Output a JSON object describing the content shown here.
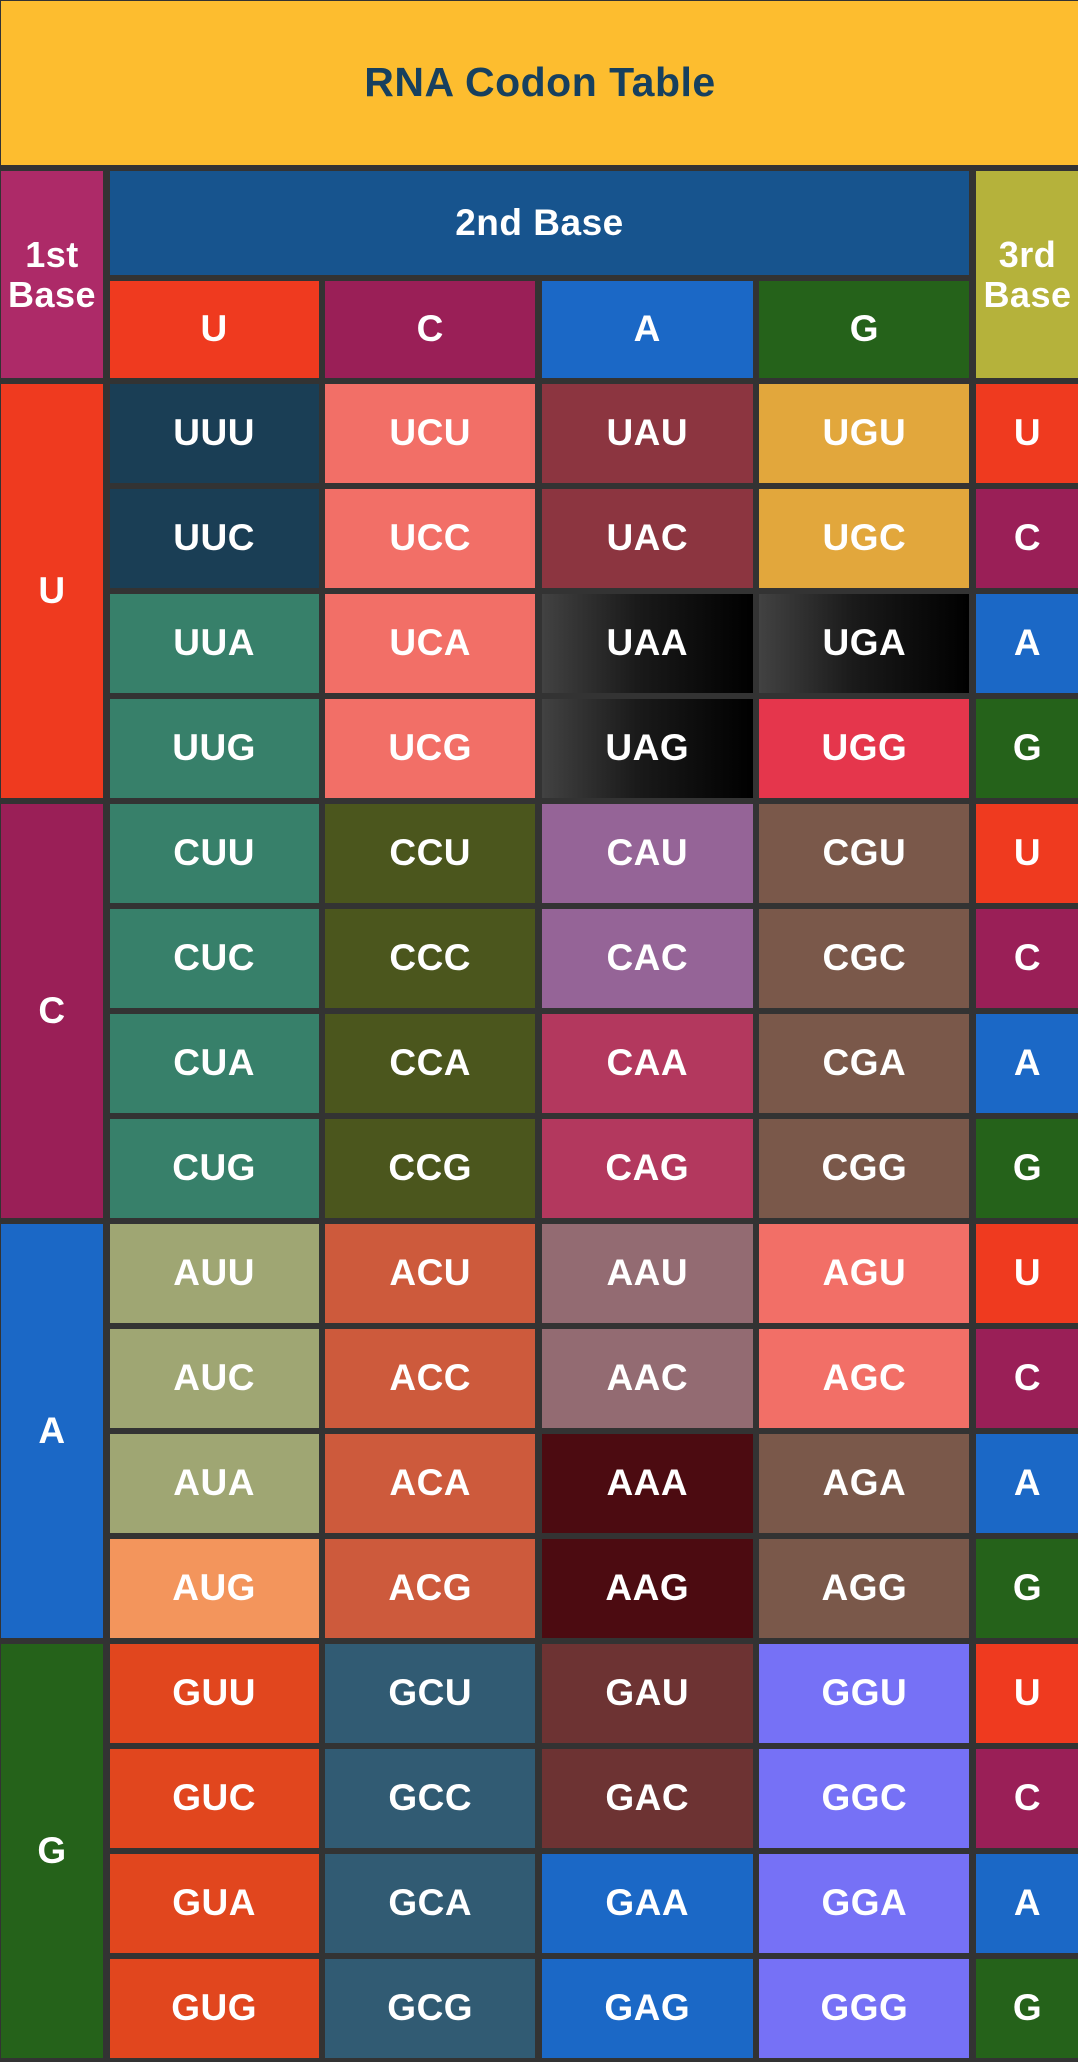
{
  "title": "RNA Codon Table",
  "headers": {
    "first_base": "1st Base",
    "second_base": "2nd Base",
    "third_base": "3rd Base"
  },
  "base_colors": {
    "U": "#ef3a1f",
    "C": "#9a1f57",
    "A": "#1b68c6",
    "G": "#25621a"
  },
  "second_base_columns": [
    {
      "label": "U",
      "color": "#ef3a1f"
    },
    {
      "label": "C",
      "color": "#9a1f57"
    },
    {
      "label": "A",
      "color": "#1b68c6"
    },
    {
      "label": "G",
      "color": "#25621a"
    }
  ],
  "first_base_rows": [
    {
      "label": "U",
      "color": "#ef3a1f"
    },
    {
      "label": "C",
      "color": "#9a1f57"
    },
    {
      "label": "A",
      "color": "#1b68c6"
    },
    {
      "label": "G",
      "color": "#25621a"
    }
  ],
  "third_base_labels": [
    "U",
    "C",
    "A",
    "G"
  ],
  "codons": [
    [
      [
        {
          "codon": "UUU",
          "color": "#1a3e55"
        },
        {
          "codon": "UCU",
          "color": "#f26f67"
        },
        {
          "codon": "UAU",
          "color": "#8c3540"
        },
        {
          "codon": "UGU",
          "color": "#e2a73c"
        }
      ],
      [
        {
          "codon": "UUC",
          "color": "#1a3e55"
        },
        {
          "codon": "UCC",
          "color": "#f26f67"
        },
        {
          "codon": "UAC",
          "color": "#8c3540"
        },
        {
          "codon": "UGC",
          "color": "#e2a73c"
        }
      ],
      [
        {
          "codon": "UUA",
          "color": "#37806a"
        },
        {
          "codon": "UCA",
          "color": "#f26f67"
        },
        {
          "codon": "UAA",
          "color": "stop"
        },
        {
          "codon": "UGA",
          "color": "stop"
        }
      ],
      [
        {
          "codon": "UUG",
          "color": "#37806a"
        },
        {
          "codon": "UCG",
          "color": "#f26f67"
        },
        {
          "codon": "UAG",
          "color": "stop"
        },
        {
          "codon": "UGG",
          "color": "#e5364c"
        }
      ]
    ],
    [
      [
        {
          "codon": "CUU",
          "color": "#37806a"
        },
        {
          "codon": "CCU",
          "color": "#4b561d"
        },
        {
          "codon": "CAU",
          "color": "#956497"
        },
        {
          "codon": "CGU",
          "color": "#7a584a"
        }
      ],
      [
        {
          "codon": "CUC",
          "color": "#37806a"
        },
        {
          "codon": "CCC",
          "color": "#4b561d"
        },
        {
          "codon": "CAC",
          "color": "#956497"
        },
        {
          "codon": "CGC",
          "color": "#7a584a"
        }
      ],
      [
        {
          "codon": "CUA",
          "color": "#37806a"
        },
        {
          "codon": "CCA",
          "color": "#4b561d"
        },
        {
          "codon": "CAA",
          "color": "#b3385e"
        },
        {
          "codon": "CGA",
          "color": "#7a584a"
        }
      ],
      [
        {
          "codon": "CUG",
          "color": "#37806a"
        },
        {
          "codon": "CCG",
          "color": "#4b561d"
        },
        {
          "codon": "CAG",
          "color": "#b3385e"
        },
        {
          "codon": "CGG",
          "color": "#7a584a"
        }
      ]
    ],
    [
      [
        {
          "codon": "AUU",
          "color": "#9fa673"
        },
        {
          "codon": "ACU",
          "color": "#cd5a3c"
        },
        {
          "codon": "AAU",
          "color": "#936b72"
        },
        {
          "codon": "AGU",
          "color": "#f26f67"
        }
      ],
      [
        {
          "codon": "AUC",
          "color": "#9fa673"
        },
        {
          "codon": "ACC",
          "color": "#cd5a3c"
        },
        {
          "codon": "AAC",
          "color": "#936b72"
        },
        {
          "codon": "AGC",
          "color": "#f26f67"
        }
      ],
      [
        {
          "codon": "AUA",
          "color": "#9fa673"
        },
        {
          "codon": "ACA",
          "color": "#cd5a3c"
        },
        {
          "codon": "AAA",
          "color": "#4c0b11"
        },
        {
          "codon": "AGA",
          "color": "#7a584a"
        }
      ],
      [
        {
          "codon": "AUG",
          "color": "#f3955c"
        },
        {
          "codon": "ACG",
          "color": "#cd5a3c"
        },
        {
          "codon": "AAG",
          "color": "#4c0b11"
        },
        {
          "codon": "AGG",
          "color": "#7a584a"
        }
      ]
    ],
    [
      [
        {
          "codon": "GUU",
          "color": "#e1461e"
        },
        {
          "codon": "GCU",
          "color": "#315b73"
        },
        {
          "codon": "GAU",
          "color": "#6d3333"
        },
        {
          "codon": "GGU",
          "color": "#7671f6"
        }
      ],
      [
        {
          "codon": "GUC",
          "color": "#e1461e"
        },
        {
          "codon": "GCC",
          "color": "#315b73"
        },
        {
          "codon": "GAC",
          "color": "#6d3333"
        },
        {
          "codon": "GGC",
          "color": "#7671f6"
        }
      ],
      [
        {
          "codon": "GUA",
          "color": "#e1461e"
        },
        {
          "codon": "GCA",
          "color": "#315b73"
        },
        {
          "codon": "GAA",
          "color": "#1b68c6"
        },
        {
          "codon": "GGA",
          "color": "#7671f6"
        }
      ],
      [
        {
          "codon": "GUG",
          "color": "#e1461e"
        },
        {
          "codon": "GCG",
          "color": "#315b73"
        },
        {
          "codon": "GAG",
          "color": "#1b68c6"
        },
        {
          "codon": "GGG",
          "color": "#7671f6"
        }
      ]
    ]
  ]
}
